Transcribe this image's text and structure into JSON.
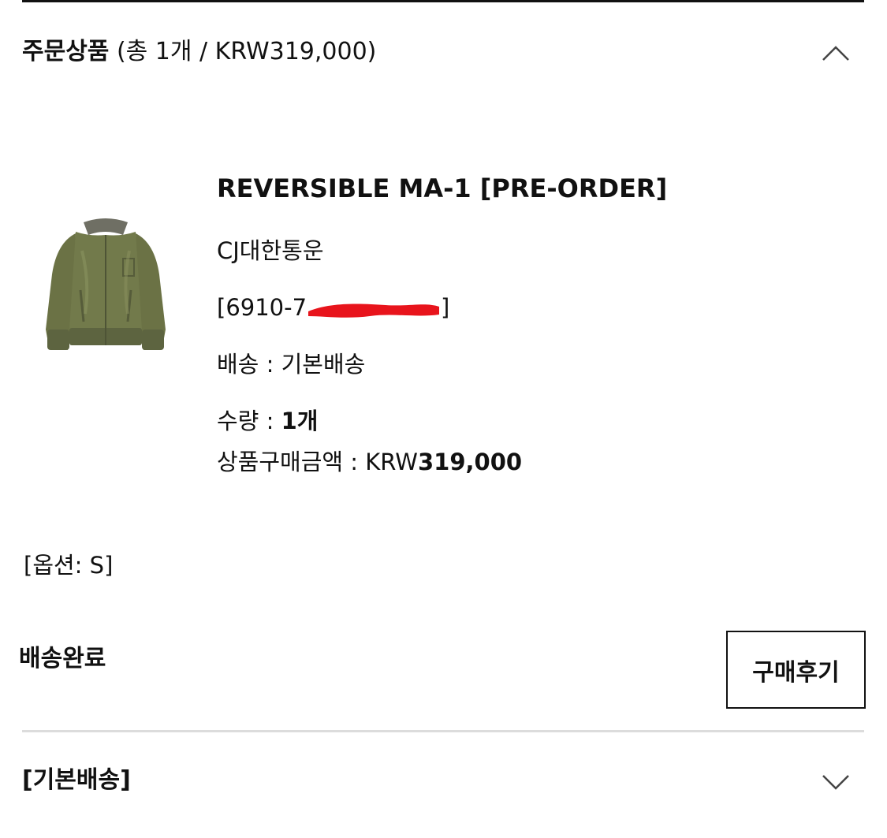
{
  "order_items": {
    "title": "주문상품",
    "summary": "(총 1개 / KRW319,000)",
    "collapse_icon": "chevron-up-icon"
  },
  "product": {
    "image_icon": "olive-bomber-jacket-image",
    "name": "REVERSIBLE MA-1 [PRE-ORDER]",
    "courier": "CJ대한통운",
    "tracking_visible": "[6910-7",
    "tracking_end": "]",
    "redaction_color": "#e8141c",
    "shipping_label": "배송 : ",
    "shipping_value": "기본배송",
    "quantity_label": "수량 : ",
    "quantity_value": "1개",
    "price_label": "상품구매금액 : KRW",
    "price_value": "319,000"
  },
  "option_text": "[옵션: S]",
  "status_text": "배송완료",
  "review_button_label": "구매후기",
  "basic_shipping": {
    "label": "[기본배송]",
    "expand_icon": "chevron-down-icon"
  }
}
